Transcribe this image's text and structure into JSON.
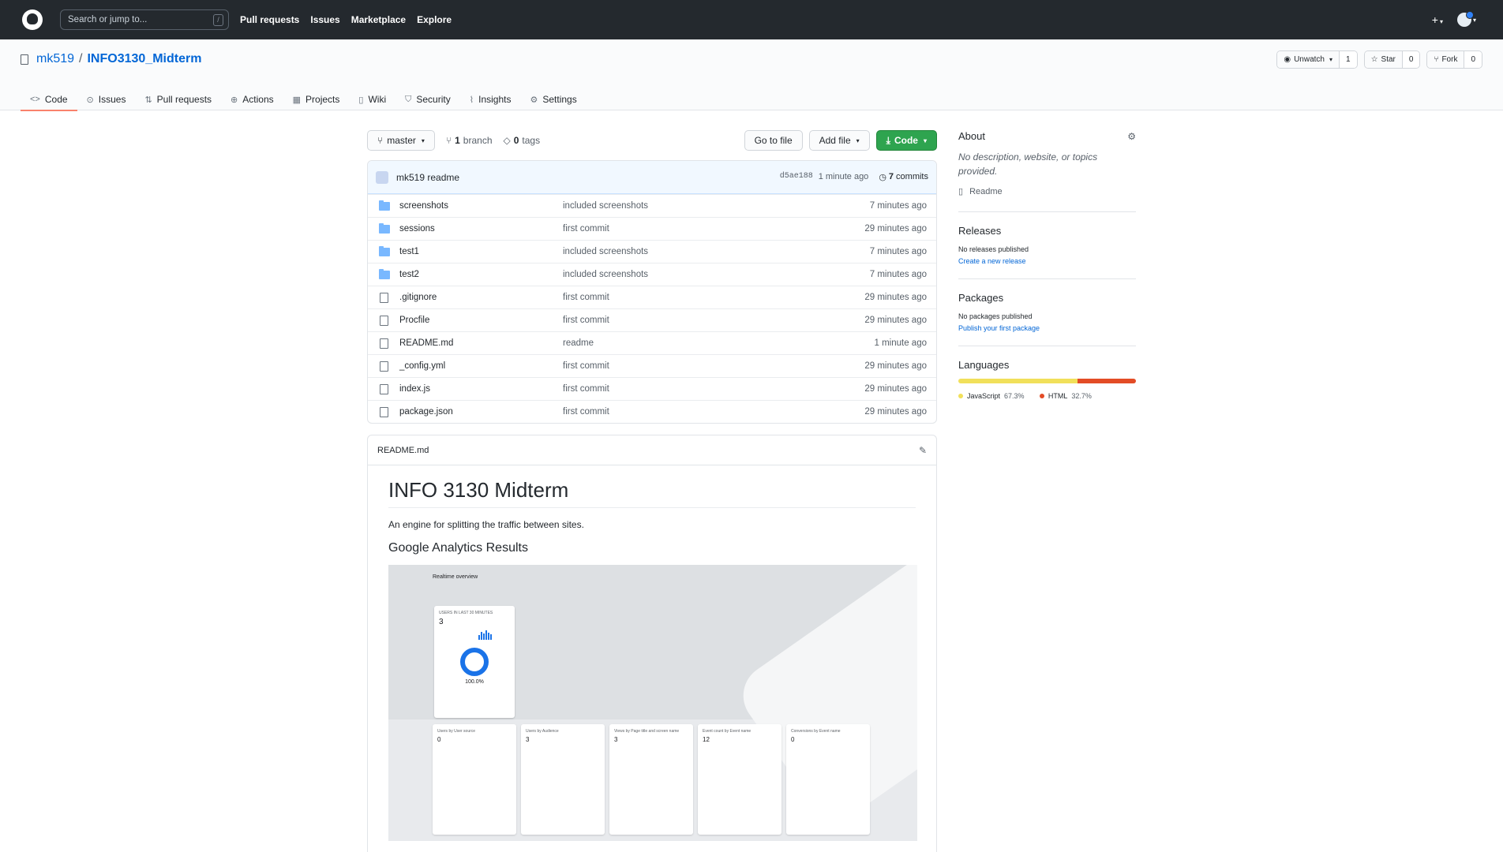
{
  "header": {
    "search_placeholder": "Search or jump to...",
    "search_key": "/",
    "nav": [
      "Pull requests",
      "Issues",
      "Marketplace",
      "Explore"
    ],
    "plus": "+"
  },
  "repo": {
    "owner": "mk519",
    "separator": "/",
    "name": "INFO3130_Midterm",
    "unwatch_label": "Unwatch",
    "unwatch_count": "1",
    "star_label": "Star",
    "star_count": "0",
    "fork_label": "Fork",
    "fork_count": "0"
  },
  "tabs": [
    {
      "label": "Code",
      "icon": "code-icon"
    },
    {
      "label": "Issues",
      "icon": "issue-icon"
    },
    {
      "label": "Pull requests",
      "icon": "pull-request-icon"
    },
    {
      "label": "Actions",
      "icon": "actions-icon"
    },
    {
      "label": "Projects",
      "icon": "projects-icon"
    },
    {
      "label": "Wiki",
      "icon": "book-icon"
    },
    {
      "label": "Security",
      "icon": "shield-icon"
    },
    {
      "label": "Insights",
      "icon": "graph-icon"
    },
    {
      "label": "Settings",
      "icon": "gear-icon"
    }
  ],
  "branchbar": {
    "branch": "master",
    "branches_count": "1",
    "branches_label": "branch",
    "tags_count": "0",
    "tags_label": "tags",
    "go_to_file": "Go to file",
    "add_file": "Add file",
    "code": "Code"
  },
  "commit": {
    "author": "mk519",
    "message": "readme",
    "sha": "d5ae188",
    "time": "1 minute ago",
    "commits_count": "7",
    "commits_label": "commits"
  },
  "files": [
    {
      "name": "screenshots",
      "type": "folder",
      "message": "included screenshots",
      "time": "7 minutes ago"
    },
    {
      "name": "sessions",
      "type": "folder",
      "message": "first commit",
      "time": "29 minutes ago"
    },
    {
      "name": "test1",
      "type": "folder",
      "message": "included screenshots",
      "time": "7 minutes ago"
    },
    {
      "name": "test2",
      "type": "folder",
      "message": "included screenshots",
      "time": "7 minutes ago"
    },
    {
      "name": ".gitignore",
      "type": "file",
      "message": "first commit",
      "time": "29 minutes ago"
    },
    {
      "name": "Procfile",
      "type": "file",
      "message": "first commit",
      "time": "29 minutes ago"
    },
    {
      "name": "README.md",
      "type": "file",
      "message": "readme",
      "time": "1 minute ago"
    },
    {
      "name": "_config.yml",
      "type": "file",
      "message": "first commit",
      "time": "29 minutes ago"
    },
    {
      "name": "index.js",
      "type": "file",
      "message": "first commit",
      "time": "29 minutes ago"
    },
    {
      "name": "package.json",
      "type": "file",
      "message": "first commit",
      "time": "29 minutes ago"
    }
  ],
  "readme": {
    "filename": "README.md",
    "title": "INFO 3130 Midterm",
    "description": "An engine for splitting the traffic between sites.",
    "subtitle": "Google Analytics Results",
    "screenshot": {
      "heading": "Realtime overview",
      "panel_label": "USERS IN LAST 30 MINUTES",
      "users": "3",
      "percent": "100.0%",
      "cards": [
        {
          "title": "Users by User source",
          "value": "0"
        },
        {
          "title": "Users by Audience",
          "value": "3"
        },
        {
          "title": "Views by Page title and screen name",
          "value": "3"
        },
        {
          "title": "Event count by Event name",
          "value": "12"
        },
        {
          "title": "Conversions by Event name",
          "value": "0"
        }
      ]
    }
  },
  "sidebar": {
    "about_title": "About",
    "about_desc": "No description, website, or topics provided.",
    "readme_link": "Readme",
    "releases_title": "Releases",
    "releases_text": "No releases published",
    "releases_link": "Create a new release",
    "packages_title": "Packages",
    "packages_text": "No packages published",
    "packages_link": "Publish your first package",
    "languages_title": "Languages",
    "languages": [
      {
        "name": "JavaScript",
        "percent": "67.3%",
        "value": 67.3,
        "color": "#f1e05a"
      },
      {
        "name": "HTML",
        "percent": "32.7%",
        "value": 32.7,
        "color": "#e34c26"
      }
    ]
  },
  "colors": {
    "accent": "#0366d6",
    "topbar": "#24292e",
    "green": "#2ea44f",
    "tab_underline": "#f9826c"
  }
}
